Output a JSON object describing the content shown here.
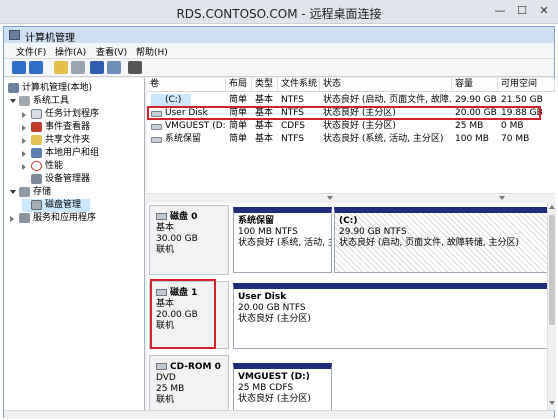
{
  "rds": {
    "title": "RDS.CONTOSO.COM - 远程桌面连接",
    "min": "—",
    "max": "☐",
    "close": "✕"
  },
  "window": {
    "title": "计算机管理"
  },
  "menu": [
    "文件(F)",
    "操作(A)",
    "查看(V)",
    "帮助(H)"
  ],
  "tree": {
    "root": "计算机管理(本地)",
    "system_tools": "系统工具",
    "task_scheduler": "任务计划程序",
    "event_viewer": "事件查看器",
    "shared_folders": "共享文件夹",
    "local_users": "本地用户和组",
    "performance": "性能",
    "device_manager": "设备管理器",
    "storage": "存储",
    "disk_mgmt": "磁盘管理",
    "services": "服务和应用程序"
  },
  "columns": [
    "卷",
    "布局",
    "类型",
    "文件系统",
    "状态",
    "容量",
    "可用空间"
  ],
  "volumes": [
    {
      "name": "(C:)",
      "layout": "简单",
      "type": "基本",
      "fs": "NTFS",
      "status": "状态良好 (启动, 页面文件, 故障...",
      "capacity": "29.90 GB",
      "free": "21.50 GB"
    },
    {
      "name": "User Disk",
      "layout": "简单",
      "type": "基本",
      "fs": "NTFS",
      "status": "状态良好 (主分区)",
      "capacity": "20.00 GB",
      "free": "19.88 GB"
    },
    {
      "name": "VMGUEST (D:)",
      "layout": "简单",
      "type": "基本",
      "fs": "CDFS",
      "status": "状态良好 (主分区)",
      "capacity": "25 MB",
      "free": "0 MB"
    },
    {
      "name": "系统保留",
      "layout": "简单",
      "type": "基本",
      "fs": "NTFS",
      "status": "状态良好 (系统, 活动, 主分区)",
      "capacity": "100 MB",
      "free": "70 MB"
    }
  ],
  "disks": [
    {
      "name": "磁盘 0",
      "type": "基本",
      "size": "30.00 GB",
      "state": "联机",
      "partitions": [
        {
          "name": "系统保留",
          "detail": "100 MB NTFS",
          "status": "状态良好 (系统, 活动, 主"
        },
        {
          "name": "(C:)",
          "detail": "29.90 GB NTFS",
          "status": "状态良好 (启动, 页面文件, 故障转储, 主分区)"
        }
      ]
    },
    {
      "name": "磁盘 1",
      "type": "基本",
      "size": "20.00 GB",
      "state": "联机",
      "partitions": [
        {
          "name": "User Disk",
          "detail": "20.00 GB NTFS",
          "status": "状态良好 (主分区)"
        }
      ]
    },
    {
      "name": "CD-ROM 0",
      "type": "DVD",
      "size": "25 MB",
      "state": "联机",
      "partitions": [
        {
          "name": "VMGUEST (D:)",
          "detail": "25 MB CDFS",
          "status": "状态良好 (主分区)"
        }
      ]
    }
  ],
  "colors": {
    "partition_header": "#1f2d7a",
    "highlight": "#d3202a",
    "selection": "#cce8ff"
  }
}
